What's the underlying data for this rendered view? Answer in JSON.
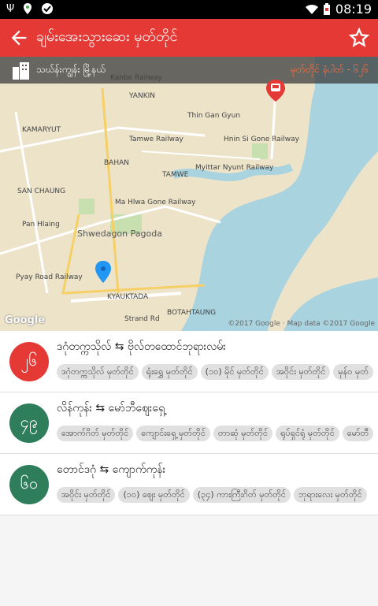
{
  "status_bar": {
    "time": "08:19"
  },
  "app_bar": {
    "title": "ချမ်းအေးသွားဆေး မှတ်တိုင်"
  },
  "map": {
    "tsp": "သဃ်န်းကျွန်း မြို့နယ်",
    "stop_number": "မှတ်တိုင် နံပါတ် - ၆၂၆",
    "labels": [
      "Kanbe Railway",
      "Thin Gan Gyun",
      "YANKIN",
      "Tamwe Railway",
      "Hnin Si Gone Railway",
      "KAMARYUT",
      "BAHAN",
      "TAMWE",
      "Myittar Nyunt Railway",
      "Ma Hlwa Gone Railway",
      "SAN CHAUNG",
      "Pan Hlaing",
      "Shwedagon Pagoda",
      "Pyay Road Railway",
      "KYAUKTADA",
      "BOTAHTAUNG",
      "Strand Rd"
    ],
    "google": "Google",
    "copyright": "©2017 Google · Map data ©2017 Google"
  },
  "routes": [
    {
      "number": "၂၆",
      "color": "#e53935",
      "title": "ဒဂုံတက္ကသိုလ် ⇆ ဗိုလ်တထောင်ဘုရားလမ်း",
      "stops": [
        "ဒဂုံတက္ကသိုလ် မှတ်တိုင်",
        "ရုံးရွှေ မှတ်တိုင်",
        "(၁၀) မိုင် မှတ်တိုင်",
        "အဝိုင်း မှတ်တိုင်",
        "မုန်ဝ မှတ်"
      ]
    },
    {
      "number": "၄၉",
      "color": "#2e7d5b",
      "title": "လိန်ကုန်း ⇆ မော်ဘီဈေးရှေ့",
      "stops": [
        "အောက်ဂိတ် မှတ်တိုင်",
        "ကျောင်းရှေ့ မှတ်တိုင်",
        "တာဆုံ မှတ်တိုင်",
        "ရုပ်ရှင်ရုံ မှတ်တိုင်",
        "မော်တီ"
      ]
    },
    {
      "number": "၆၀",
      "color": "#2e7d5b",
      "title": "တောင်ဒဂုံ ⇆ ကျောက်ကုန်း",
      "stops": [
        "အဝိုင်း မှတ်တိုင်",
        "(၁၀) ဈေး မှတ်တိုင်",
        "(၃၄) ကားကြီးဂိတ် မှတ်တိုင်",
        "ဘုရားလေး မှတ်တိုင်"
      ]
    }
  ]
}
